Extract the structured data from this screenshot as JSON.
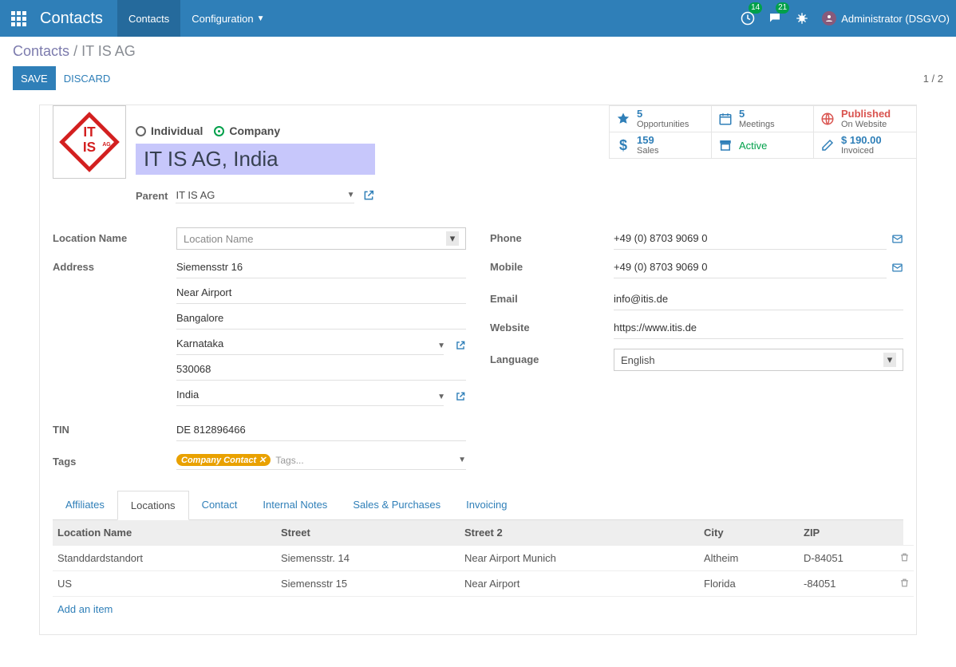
{
  "nav": {
    "app_title": "Contacts",
    "items": [
      "Contacts",
      "Configuration"
    ],
    "msg_badge": "14",
    "chat_badge": "21",
    "user_label": "Administrator (DSGVO)"
  },
  "breadcrumb": {
    "root": "Contacts",
    "current": "IT IS AG"
  },
  "buttons": {
    "save": "SAVE",
    "discard": "DISCARD"
  },
  "pager": "1 / 2",
  "record": {
    "type_individual": "Individual",
    "type_company": "Company",
    "name": "IT IS AG, India",
    "parent_label": "Parent",
    "parent_value": "IT IS AG"
  },
  "stats": {
    "opp_num": "5",
    "opp_lbl": "Opportunities",
    "meet_num": "5",
    "meet_lbl": "Meetings",
    "pub_lbl": "Published",
    "pub_sub": "On Website",
    "sales_num": "159",
    "sales_lbl": "Sales",
    "active": "Active",
    "inv_num": "$ 190.00",
    "inv_lbl": "Invoiced"
  },
  "labels": {
    "location_name": "Location Name",
    "address": "Address",
    "tin": "TIN",
    "tags": "Tags",
    "phone": "Phone",
    "mobile": "Mobile",
    "email": "Email",
    "website": "Website",
    "language": "Language"
  },
  "addr": {
    "loc_placeholder": "Location Name",
    "street": "Siemensstr 16",
    "street2": "Near Airport",
    "city": "Bangalore",
    "state": "Karnataka",
    "zip": "530068",
    "country": "India",
    "tin": "DE 812896466",
    "tag": "Company Contact",
    "tags_placeholder": "Tags..."
  },
  "contact": {
    "phone": "+49 (0) 8703 9069 0",
    "mobile": "+49 (0) 8703 9069 0",
    "email": "info@itis.de",
    "website": "https://www.itis.de",
    "language": "English"
  },
  "tabs": [
    "Affiliates",
    "Locations",
    "Contact",
    "Internal Notes",
    "Sales & Purchases",
    "Invoicing"
  ],
  "loc_table": {
    "headers": [
      "Location Name",
      "Street",
      "Street 2",
      "City",
      "ZIP"
    ],
    "rows": [
      {
        "name": "Standdardstandort",
        "street": "Siemensstr. 14",
        "street2": "Near Airport Munich",
        "city": "Altheim",
        "zip": "D-84051"
      },
      {
        "name": "US",
        "street": "Siemensstr 15",
        "street2": "Near Airport",
        "city": "Florida",
        "zip": "-84051"
      }
    ],
    "add": "Add an item"
  }
}
